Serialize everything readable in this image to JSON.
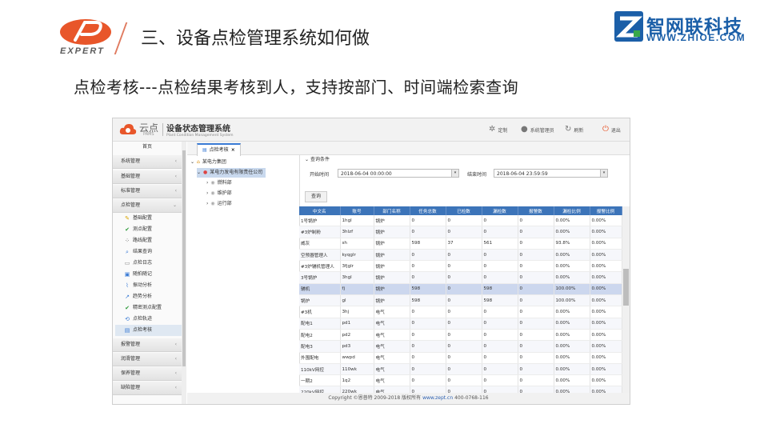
{
  "slide": {
    "logo_text": "EXPERT",
    "title": "三、设备点检管理系统如何做",
    "subtitle": "点检考核---点检结果考核到人，支持按部门、时间端检索查询",
    "brand_name": "智网联科技",
    "brand_url": "WWW.ZHIOE.COM",
    "brand_mark": "Z"
  },
  "app": {
    "brand": "云点",
    "brand_sub": "PAMS",
    "name": "设备状态管理系统",
    "name_en": "Plant Condition Management System",
    "top_buttons": [
      {
        "label": "定制",
        "icon": "puzzle-icon"
      },
      {
        "label": "系统管理员",
        "icon": "user-icon"
      },
      {
        "label": "刷新",
        "icon": "refresh-icon"
      },
      {
        "label": "退出",
        "icon": "power-icon"
      }
    ],
    "sidebar": {
      "home": "首页",
      "top_items": [
        "系统管理",
        "基础管理",
        "标准管理",
        "点检管理"
      ],
      "sub_items": [
        {
          "label": "基础配置",
          "icon": "pencil-icon"
        },
        {
          "label": "测点配置",
          "icon": "check-icon"
        },
        {
          "label": "路线配置",
          "icon": "route-icon"
        },
        {
          "label": "结果查询",
          "icon": "search-doc-icon"
        },
        {
          "label": "点检日志",
          "icon": "log-icon"
        },
        {
          "label": "随拍随记",
          "icon": "camera-icon"
        },
        {
          "label": "振动分析",
          "icon": "wave-icon"
        },
        {
          "label": "趋势分析",
          "icon": "trend-icon"
        },
        {
          "label": "精密测点配置",
          "icon": "check-icon"
        },
        {
          "label": "点检轨迹",
          "icon": "track-icon"
        },
        {
          "label": "点检考核",
          "icon": "assess-icon"
        }
      ],
      "bottom_items": [
        "报警管理",
        "润滑管理",
        "保养管理",
        "缺陷管理"
      ]
    },
    "tab": {
      "label": "点检考核",
      "close": "×"
    },
    "tree": {
      "root": "某电力集团",
      "company": "某电力发电有限责任公司",
      "depts": [
        "燃料部",
        "维护部",
        "运行部"
      ]
    },
    "query": {
      "section": "查询条件",
      "start_label": "开始时间",
      "start_value": "2018-06-04 00:00:00",
      "end_label": "结束时间",
      "end_value": "2018-06-04 23:59:59",
      "button": "查询"
    },
    "table": {
      "columns": [
        "中文名",
        "账号",
        "部门名称",
        "任务总数",
        "已检数",
        "漏检数",
        "报警数",
        "漏检比例",
        "报警比例"
      ],
      "rows": [
        [
          "1号锅炉",
          "1hgl",
          "锅炉",
          "0",
          "0",
          "0",
          "0",
          "0.00%",
          "0.00%"
        ],
        [
          "#3炉制粉",
          "3hlzf",
          "锅炉",
          "0",
          "0",
          "0",
          "0",
          "0.00%",
          "0.00%"
        ],
        [
          "威灰",
          "sh",
          "锅炉",
          "598",
          "37",
          "561",
          "0",
          "93.8%",
          "0.00%"
        ],
        [
          "空预器管理人",
          "kyqglr",
          "锅炉",
          "0",
          "0",
          "0",
          "0",
          "0.00%",
          "0.00%"
        ],
        [
          "#3炉辅机管理人",
          "3fjglr",
          "锅炉",
          "0",
          "0",
          "0",
          "0",
          "0.00%",
          "0.00%"
        ],
        [
          "3号锅炉",
          "3hgl",
          "锅炉",
          "0",
          "0",
          "0",
          "0",
          "0.00%",
          "0.00%"
        ],
        [
          "辅机",
          "fj",
          "锅炉",
          "598",
          "0",
          "598",
          "0",
          "100.00%",
          "0.00%"
        ],
        [
          "锅炉",
          "gl",
          "锅炉",
          "598",
          "0",
          "598",
          "0",
          "100.00%",
          "0.00%"
        ],
        [
          "#3机",
          "3hj",
          "电气",
          "0",
          "0",
          "0",
          "0",
          "0.00%",
          "0.00%"
        ],
        [
          "配电1",
          "pd1",
          "电气",
          "0",
          "0",
          "0",
          "0",
          "0.00%",
          "0.00%"
        ],
        [
          "配电2",
          "pd2",
          "电气",
          "0",
          "0",
          "0",
          "0",
          "0.00%",
          "0.00%"
        ],
        [
          "配电3",
          "pd3",
          "电气",
          "0",
          "0",
          "0",
          "0",
          "0.00%",
          "0.00%"
        ],
        [
          "外围配电",
          "wwpd",
          "电气",
          "0",
          "0",
          "0",
          "0",
          "0.00%",
          "0.00%"
        ],
        [
          "110kV网控",
          "110wk",
          "电气",
          "0",
          "0",
          "0",
          "0",
          "0.00%",
          "0.00%"
        ],
        [
          "一期2",
          "1q2",
          "电气",
          "0",
          "0",
          "0",
          "0",
          "0.00%",
          "0.00%"
        ],
        [
          "220kV网控",
          "220wk",
          "电气",
          "0",
          "0",
          "0",
          "0",
          "0.00%",
          "0.00%"
        ]
      ],
      "highlight_row": 6
    },
    "footer": {
      "copyright": "Copyright ©恩普特 2009-2018  版权所有",
      "site": "www.zept.cn",
      "phone": "400-0768-116"
    }
  },
  "colors": {
    "accent": "#3c74b9",
    "brand_blue": "#1b5fa8",
    "logo_orange": "#e8562a"
  }
}
